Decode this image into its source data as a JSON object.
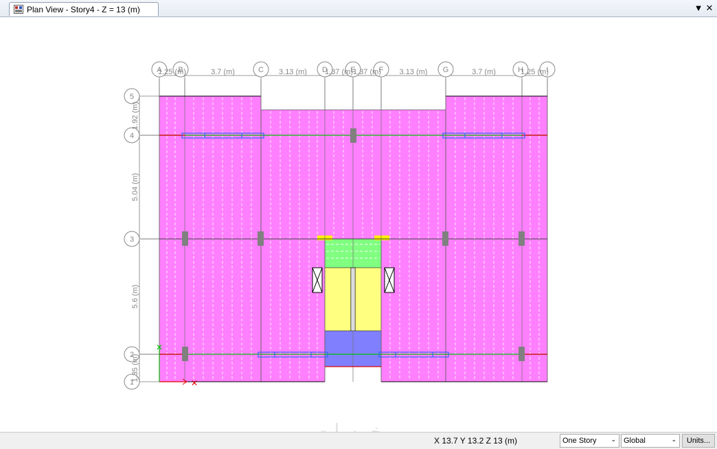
{
  "tab": {
    "title": "Plan View - Story4 - Z = 13 (m)",
    "icon": "plan-view-icon"
  },
  "window_controls": {
    "dropdown": "▼",
    "close": "✕"
  },
  "grid": {
    "columns": [
      "A",
      "B",
      "C",
      "D",
      "E",
      "F",
      "G",
      "H",
      "I"
    ],
    "rows": [
      "5",
      "4",
      "3",
      "2",
      "1"
    ],
    "col_dims": [
      "1.25 (m)",
      "3.7 (m)",
      "3.13 (m)",
      "1.37 (m)",
      "1.37 (m)",
      "3.13 (m)",
      "3.7 (m)",
      "1.25 (m)"
    ],
    "row_dims": [
      "1.92 (m)",
      "5.04 (m)",
      "5.6 (m)",
      "1.35 (m)"
    ]
  },
  "colors": {
    "slab": "#ff80ff",
    "stair": "#ffff80",
    "landing": "#80ff80",
    "shaft": "#8080ff",
    "column": "#808080",
    "beam": "#00c000",
    "edge_beam": "#e00000"
  },
  "status": {
    "coords": "X 13.7  Y 13.2  Z 13 (m)"
  },
  "dropdowns": {
    "story": "One Story",
    "coord_system": "Global"
  },
  "buttons": {
    "units": "Units..."
  },
  "watermark": "خمسات"
}
